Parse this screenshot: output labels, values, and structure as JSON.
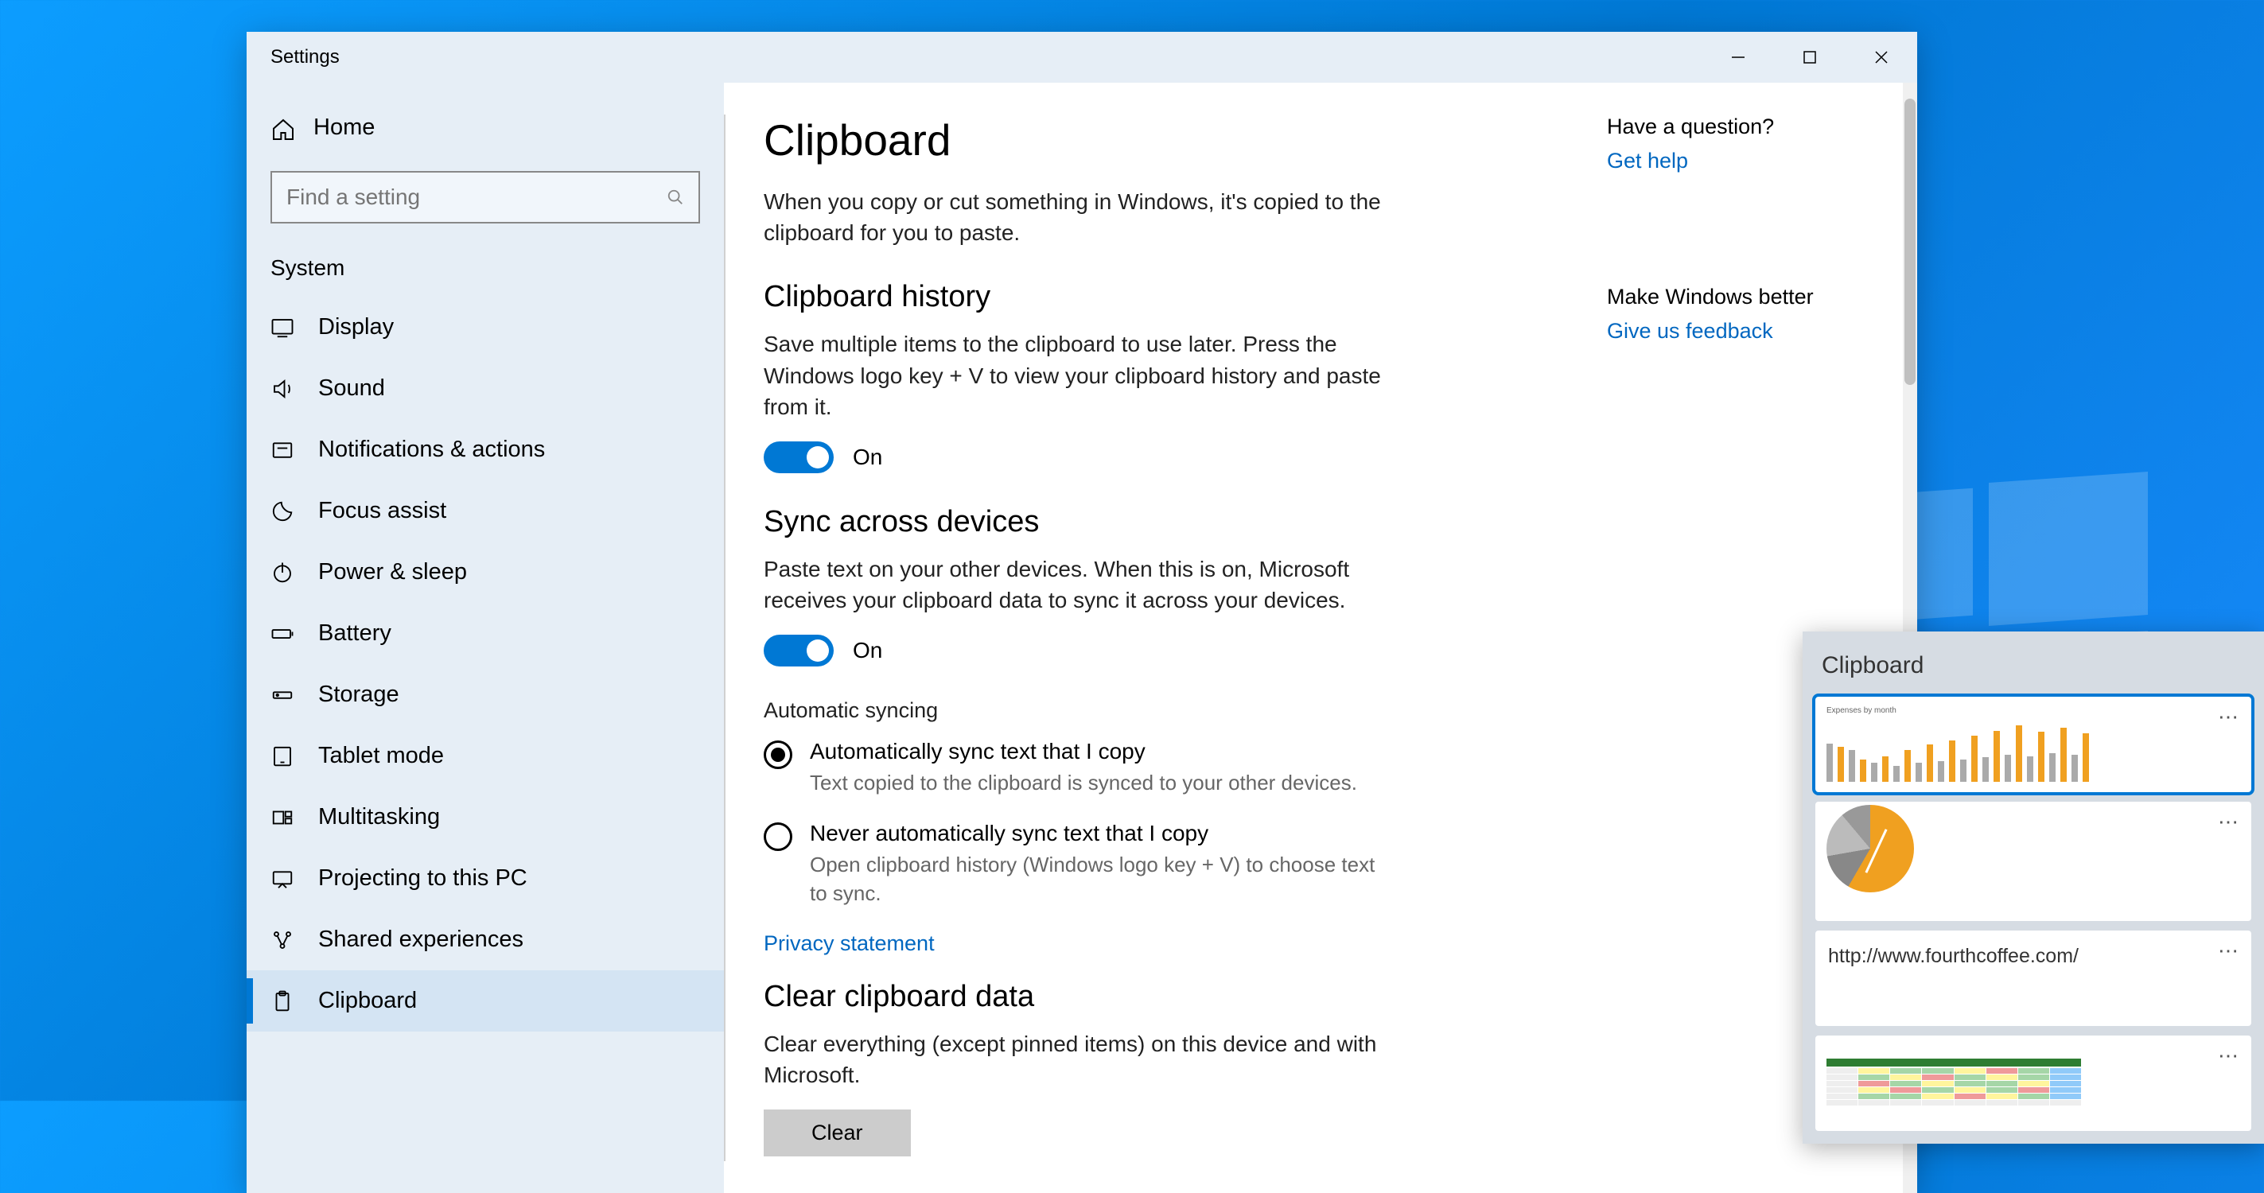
{
  "titlebar": {
    "app_name": "Settings"
  },
  "sidebar": {
    "home": "Home",
    "search_placeholder": "Find a setting",
    "category": "System",
    "items": [
      {
        "label": "Display"
      },
      {
        "label": "Sound"
      },
      {
        "label": "Notifications & actions"
      },
      {
        "label": "Focus assist"
      },
      {
        "label": "Power & sleep"
      },
      {
        "label": "Battery"
      },
      {
        "label": "Storage"
      },
      {
        "label": "Tablet mode"
      },
      {
        "label": "Multitasking"
      },
      {
        "label": "Projecting to this PC"
      },
      {
        "label": "Shared experiences"
      },
      {
        "label": "Clipboard"
      }
    ]
  },
  "main": {
    "title": "Clipboard",
    "intro": "When you copy or cut something in Windows, it's copied to the clipboard for you to paste.",
    "section_history": {
      "title": "Clipboard history",
      "desc": "Save multiple items to the clipboard to use later. Press the Windows logo key + V to view your clipboard history and paste from it.",
      "toggle_state": "On"
    },
    "section_sync": {
      "title": "Sync across devices",
      "desc": "Paste text on your other devices. When this is on, Microsoft receives your clipboard data to sync it across your devices.",
      "toggle_state": "On",
      "auto_label": "Automatic syncing",
      "option1": {
        "label": "Automatically sync text that I copy",
        "desc": "Text copied to the clipboard is synced to your other devices."
      },
      "option2": {
        "label": "Never automatically sync text that I copy",
        "desc": "Open clipboard history (Windows logo key + V) to choose text to sync."
      }
    },
    "privacy_link": "Privacy statement",
    "section_clear": {
      "title": "Clear clipboard data",
      "desc": "Clear everything (except pinned items) on this device and with Microsoft.",
      "button": "Clear"
    }
  },
  "related": {
    "question": "Have a question?",
    "get_help": "Get help",
    "better": "Make Windows better",
    "feedback": "Give us feedback"
  },
  "flyout": {
    "title": "Clipboard",
    "chart_title": "Expenses by month",
    "url_text": "http://www.fourthcoffee.com/"
  }
}
